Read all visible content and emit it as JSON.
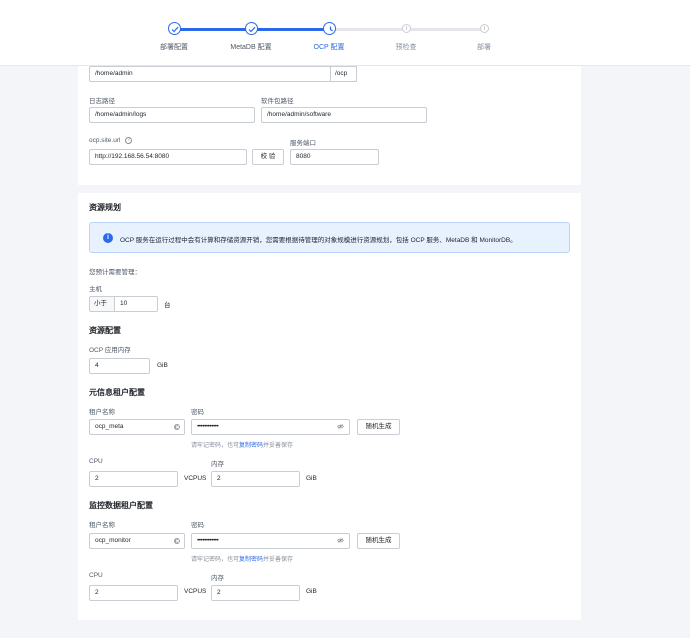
{
  "steps": [
    {
      "label": "部署配置",
      "state": "done"
    },
    {
      "label": "MetaDB 配置",
      "state": "done"
    },
    {
      "label": "OCP 配置",
      "state": "active"
    },
    {
      "label": "预检查",
      "state": "wait"
    },
    {
      "label": "部署",
      "state": "wait"
    }
  ],
  "crumb": "",
  "paths": {
    "home_value": "/home/admin",
    "home_suffix": "/ocp",
    "log_label": "日志路径",
    "log_value": "/home/admin/logs",
    "pkg_label": "软件包路径",
    "pkg_value": "/home/admin/software",
    "url_label": "ocp.site.url",
    "url_value": "http://192.168.56.54:8080",
    "verify_button": "校 验",
    "port_label": "服务端口",
    "port_value": "8080"
  },
  "resource": {
    "title": "资源规划",
    "alert": "OCP 服务在运行过程中会有计算和存储资源开销，您需要根据待管理的对象规模进行资源规划，包括 OCP 服务、MetaDB 和 MonitorDB。",
    "manage_label": "您预计需要管理：",
    "host_label": "主机",
    "host_compare": "小于",
    "host_value": "10",
    "host_unit": "台",
    "config_title": "资源配置",
    "mem_label": "OCP 应用内存",
    "mem_value": "4",
    "mem_unit": "GiB"
  },
  "meta_tenant": {
    "title": "元信息租户配置",
    "name_label": "租户名称",
    "name_value": "ocp_meta",
    "pwd_label": "密码",
    "pwd_value": "••••••••••••",
    "random_button": "随机生成",
    "hint_pre": "请牢记密码，也可",
    "hint_link": "复制密码",
    "hint_post": "并妥善保存",
    "cpu_label": "CPU",
    "cpu_value": "2",
    "cpu_unit": "VCPUS",
    "memory_label": "内存",
    "memory_value": "2",
    "memory_unit": "GiB"
  },
  "monitor_tenant": {
    "title": "监控数据租户配置",
    "name_label": "租户名称",
    "name_value": "ocp_monitor",
    "pwd_label": "密码",
    "pwd_value": "••••••••••••",
    "random_button": "随机生成",
    "hint_pre": "请牢记密码，也可",
    "hint_link": "复制密码",
    "hint_post": "并妥善保存",
    "cpu_label": "CPU",
    "cpu_value": "2",
    "cpu_unit": "VCPUS",
    "memory_label": "内存",
    "memory_value": "2",
    "memory_unit": "GiB"
  },
  "colors": {
    "primary": "#2c69e8",
    "info_bg": "#e8f2ff",
    "page_bg": "#f3f5f9"
  }
}
